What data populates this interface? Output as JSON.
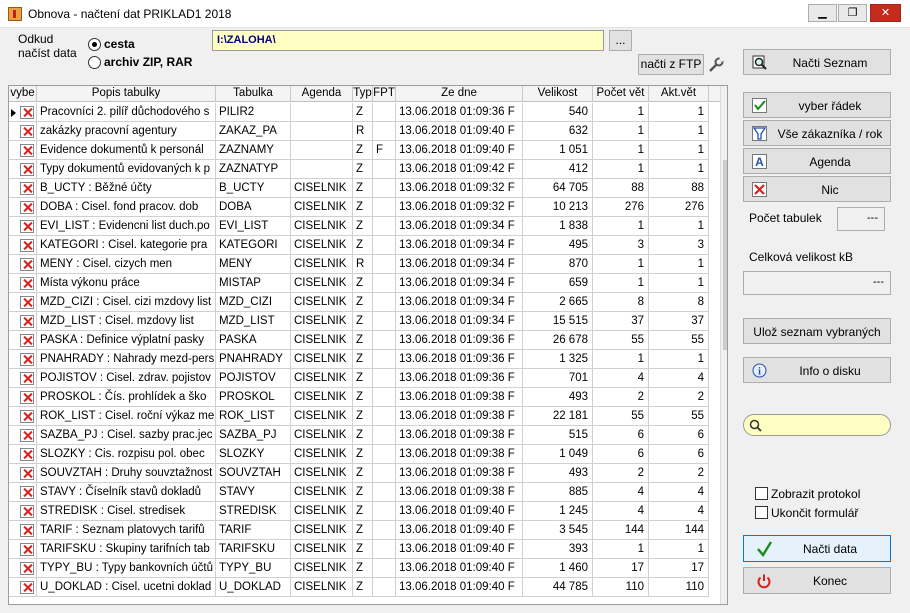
{
  "window": {
    "title": "Obnova - načtení dat   PRIKLAD1   2018",
    "min": "▁",
    "max": "❐",
    "close": "✕"
  },
  "source": {
    "label_line1": "Odkud",
    "label_line2": "načíst data",
    "option_cesta": "cesta",
    "option_archiv": "archiv ZIP, RAR",
    "path": "I:\\ZALOHA\\",
    "browse": "...",
    "ftp": "načti z FTP"
  },
  "columns": [
    "vybe",
    "Popis tabulky",
    "Tabulka",
    "Agenda",
    "Typ",
    "FPT",
    "Ze dne",
    "Velikost",
    "Počet vět",
    "Akt.vět"
  ],
  "rows": [
    {
      "popis": "Pracovníci 2. pilíř důchodového s",
      "tabulka": "PILIR2",
      "agenda": "",
      "typ": "Z",
      "fpt": "",
      "datum": "13.06.2018 01:09:36 F",
      "velikost": "540",
      "pocet": "1",
      "akt": "1"
    },
    {
      "popis": "zakázky pracovní agentury",
      "tabulka": "ZAKAZ_PA",
      "agenda": "",
      "typ": "R",
      "fpt": "",
      "datum": "13.06.2018 01:09:40 F",
      "velikost": "632",
      "pocet": "1",
      "akt": "1"
    },
    {
      "popis": "Evidence dokumentů k personál",
      "tabulka": "ZAZNAMY",
      "agenda": "",
      "typ": "Z",
      "fpt": "F",
      "datum": "13.06.2018 01:09:40 F",
      "velikost": "1 051",
      "pocet": "1",
      "akt": "1"
    },
    {
      "popis": "Typy dokumentů evidovaných k p",
      "tabulka": "ZAZNATYP",
      "agenda": "",
      "typ": "Z",
      "fpt": "",
      "datum": "13.06.2018 01:09:42 F",
      "velikost": "412",
      "pocet": "1",
      "akt": "1"
    },
    {
      "popis": "B_UCTY   : Běžné účty",
      "tabulka": "B_UCTY",
      "agenda": "CISELNIK",
      "typ": "Z",
      "fpt": "",
      "datum": "13.06.2018 01:09:32 F",
      "velikost": "64 705",
      "pocet": "88",
      "akt": "88"
    },
    {
      "popis": "DOBA    : Cisel. fond pracov. dob",
      "tabulka": "DOBA",
      "agenda": "CISELNIK",
      "typ": "Z",
      "fpt": "",
      "datum": "13.06.2018 01:09:32 F",
      "velikost": "10 213",
      "pocet": "276",
      "akt": "276"
    },
    {
      "popis": "EVI_LIST : Evidencni list duch.po",
      "tabulka": "EVI_LIST",
      "agenda": "CISELNIK",
      "typ": "Z",
      "fpt": "",
      "datum": "13.06.2018 01:09:34 F",
      "velikost": "1 838",
      "pocet": "1",
      "akt": "1"
    },
    {
      "popis": "KATEGORI : Cisel. kategorie pra",
      "tabulka": "KATEGORI",
      "agenda": "CISELNIK",
      "typ": "Z",
      "fpt": "",
      "datum": "13.06.2018 01:09:34 F",
      "velikost": "495",
      "pocet": "3",
      "akt": "3"
    },
    {
      "popis": "MENY    : Cisel. cizych men",
      "tabulka": "MENY",
      "agenda": "CISELNIK",
      "typ": "R",
      "fpt": "",
      "datum": "13.06.2018 01:09:34 F",
      "velikost": "870",
      "pocet": "1",
      "akt": "1"
    },
    {
      "popis": "Místa výkonu práce",
      "tabulka": "MISTAP",
      "agenda": "CISELNIK",
      "typ": "Z",
      "fpt": "",
      "datum": "13.06.2018 01:09:34 F",
      "velikost": "659",
      "pocet": "1",
      "akt": "1"
    },
    {
      "popis": "MZD_CIZI : Cisel. cizi mzdovy list",
      "tabulka": "MZD_CIZI",
      "agenda": "CISELNIK",
      "typ": "Z",
      "fpt": "",
      "datum": "13.06.2018 01:09:34 F",
      "velikost": "2 665",
      "pocet": "8",
      "akt": "8"
    },
    {
      "popis": "MZD_LIST : Cisel. mzdovy list",
      "tabulka": "MZD_LIST",
      "agenda": "CISELNIK",
      "typ": "Z",
      "fpt": "",
      "datum": "13.06.2018 01:09:34 F",
      "velikost": "15 515",
      "pocet": "37",
      "akt": "37"
    },
    {
      "popis": "PASKA   : Definice výplatní pasky",
      "tabulka": "PASKA",
      "agenda": "CISELNIK",
      "typ": "Z",
      "fpt": "",
      "datum": "13.06.2018 01:09:36 F",
      "velikost": "26 678",
      "pocet": "55",
      "akt": "55"
    },
    {
      "popis": "PNAHRADY : Nahrady mezd-pers",
      "tabulka": "PNAHRADY",
      "agenda": "CISELNIK",
      "typ": "Z",
      "fpt": "",
      "datum": "13.06.2018 01:09:36 F",
      "velikost": "1 325",
      "pocet": "1",
      "akt": "1"
    },
    {
      "popis": "POJISTOV : Cisel. zdrav. pojistov",
      "tabulka": "POJISTOV",
      "agenda": "CISELNIK",
      "typ": "Z",
      "fpt": "",
      "datum": "13.06.2018 01:09:36 F",
      "velikost": "701",
      "pocet": "4",
      "akt": "4"
    },
    {
      "popis": "PROSKOL  : Čís. prohlídek a ško",
      "tabulka": "PROSKOL",
      "agenda": "CISELNIK",
      "typ": "Z",
      "fpt": "",
      "datum": "13.06.2018 01:09:38 F",
      "velikost": "493",
      "pocet": "2",
      "akt": "2"
    },
    {
      "popis": "ROK_LIST : Cisel. roční výkaz me",
      "tabulka": "ROK_LIST",
      "agenda": "CISELNIK",
      "typ": "Z",
      "fpt": "",
      "datum": "13.06.2018 01:09:38 F",
      "velikost": "22 181",
      "pocet": "55",
      "akt": "55"
    },
    {
      "popis": "SAZBA_PJ : Cisel. sazby prac.jec",
      "tabulka": "SAZBA_PJ",
      "agenda": "CISELNIK",
      "typ": "Z",
      "fpt": "",
      "datum": "13.06.2018 01:09:38 F",
      "velikost": "515",
      "pocet": "6",
      "akt": "6"
    },
    {
      "popis": "SLOZKY  : Cis. rozpisu pol. obec",
      "tabulka": "SLOZKY",
      "agenda": "CISELNIK",
      "typ": "Z",
      "fpt": "",
      "datum": "13.06.2018 01:09:38 F",
      "velikost": "1 049",
      "pocet": "6",
      "akt": "6"
    },
    {
      "popis": "SOUVZTAH : Druhy souvztažnost",
      "tabulka": "SOUVZTAH",
      "agenda": "CISELNIK",
      "typ": "Z",
      "fpt": "",
      "datum": "13.06.2018 01:09:38 F",
      "velikost": "493",
      "pocet": "2",
      "akt": "2"
    },
    {
      "popis": "STAVY   : Číselník stavů dokladů",
      "tabulka": "STAVY",
      "agenda": "CISELNIK",
      "typ": "Z",
      "fpt": "",
      "datum": "13.06.2018 01:09:38 F",
      "velikost": "885",
      "pocet": "4",
      "akt": "4"
    },
    {
      "popis": "STREDISK : Cisel. stredisek",
      "tabulka": "STREDISK",
      "agenda": "CISELNIK",
      "typ": "Z",
      "fpt": "",
      "datum": "13.06.2018 01:09:40 F",
      "velikost": "1 245",
      "pocet": "4",
      "akt": "4"
    },
    {
      "popis": "TARIF   : Seznam platovych tarifů",
      "tabulka": "TARIF",
      "agenda": "CISELNIK",
      "typ": "Z",
      "fpt": "",
      "datum": "13.06.2018 01:09:40 F",
      "velikost": "3 545",
      "pocet": "144",
      "akt": "144"
    },
    {
      "popis": "TARIFSKU : Skupiny tarifních tab",
      "tabulka": "TARIFSKU",
      "agenda": "CISELNIK",
      "typ": "Z",
      "fpt": "",
      "datum": "13.06.2018 01:09:40 F",
      "velikost": "393",
      "pocet": "1",
      "akt": "1"
    },
    {
      "popis": "TYPY_BU : Typy bankovních účtů",
      "tabulka": "TYPY_BU",
      "agenda": "CISELNIK",
      "typ": "Z",
      "fpt": "",
      "datum": "13.06.2018 01:09:40 F",
      "velikost": "1 460",
      "pocet": "17",
      "akt": "17"
    },
    {
      "popis": "U_DOKLAD : Cisel. ucetni doklad",
      "tabulka": "U_DOKLAD",
      "agenda": "CISELNIK",
      "typ": "Z",
      "fpt": "",
      "datum": "13.06.2018 01:09:40 F",
      "velikost": "44 785",
      "pocet": "110",
      "akt": "110"
    }
  ],
  "buttons": {
    "nacti_seznam": "Načti Seznam",
    "vyber_radek": "vyber řádek",
    "vse_zakaznika": "Vše zákazníka / rok",
    "agenda": "Agenda",
    "nic": "Nic",
    "uloz_seznam": "Ulož seznam vybraných",
    "info_disk": "Info o disku",
    "nacti_data": "Načti data",
    "konec": "Konec"
  },
  "stats": {
    "pocet_tabulek_label": "Počet tabulek",
    "pocet_tabulek_value": "---",
    "celkova_label": "Celková velikost  kB",
    "celkova_value": "---"
  },
  "options": {
    "zobrazit_protokol": "Zobrazit protokol",
    "ukoncit_formular": "Ukončit formulář"
  },
  "colors": {
    "path_bg": "#ffffc4",
    "x_red": "#d8201c",
    "check_green": "#1a8c1a"
  }
}
